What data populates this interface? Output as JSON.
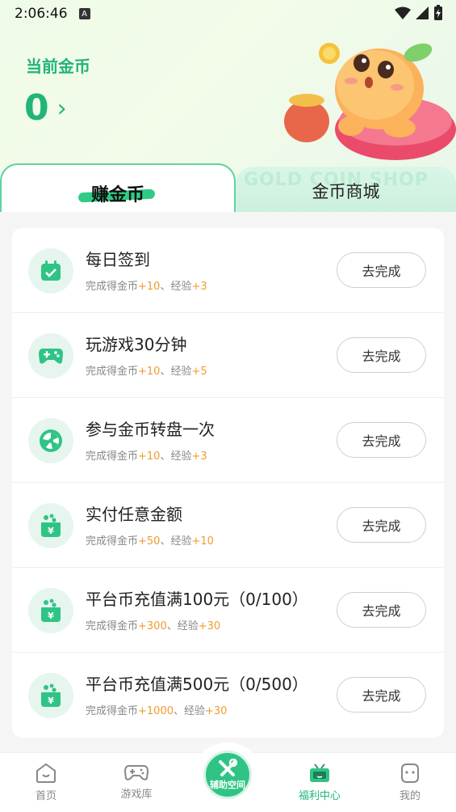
{
  "status": {
    "time": "2:06:46",
    "a_badge": "A"
  },
  "coins": {
    "label": "当前金币",
    "value": "0"
  },
  "tabs": {
    "earn": "赚金币",
    "shop": "金币商城",
    "shop_watermark": "GOLD COIN SHOP"
  },
  "tasks": [
    {
      "title": "每日签到",
      "sub_prefix": "完成得金币",
      "coin": "+10",
      "sep": "、经验",
      "exp": "+3",
      "button": "去完成",
      "icon": "calendar-check-icon"
    },
    {
      "title": "玩游戏30分钟",
      "sub_prefix": "完成得金币",
      "coin": "+10",
      "sep": "、经验",
      "exp": "+5",
      "button": "去完成",
      "icon": "gamepad-icon"
    },
    {
      "title": "参与金币转盘一次",
      "sub_prefix": "完成得金币",
      "coin": "+10",
      "sep": "、经验",
      "exp": "+3",
      "button": "去完成",
      "icon": "wheel-icon"
    },
    {
      "title": "实付任意金额",
      "sub_prefix": "完成得金币",
      "coin": "+50",
      "sep": "、经验",
      "exp": "+10",
      "button": "去完成",
      "icon": "yen-pouch-icon"
    },
    {
      "title": "平台币充值满100元（0/100）",
      "sub_prefix": "完成得金币",
      "coin": "+300",
      "sep": "、经验",
      "exp": "+30",
      "button": "去完成",
      "icon": "yen-pouch-icon"
    },
    {
      "title": "平台币充值满500元（0/500）",
      "sub_prefix": "完成得金币",
      "coin": "+1000",
      "sep": "、经验",
      "exp": "+30",
      "button": "去完成",
      "icon": "yen-pouch-icon"
    }
  ],
  "nav": {
    "home": "首页",
    "games": "游戏库",
    "center": "辅助空间",
    "welfare": "福利中心",
    "mine": "我的"
  },
  "colors": {
    "accent": "#23b47a",
    "highlight": "#f29b2d"
  }
}
